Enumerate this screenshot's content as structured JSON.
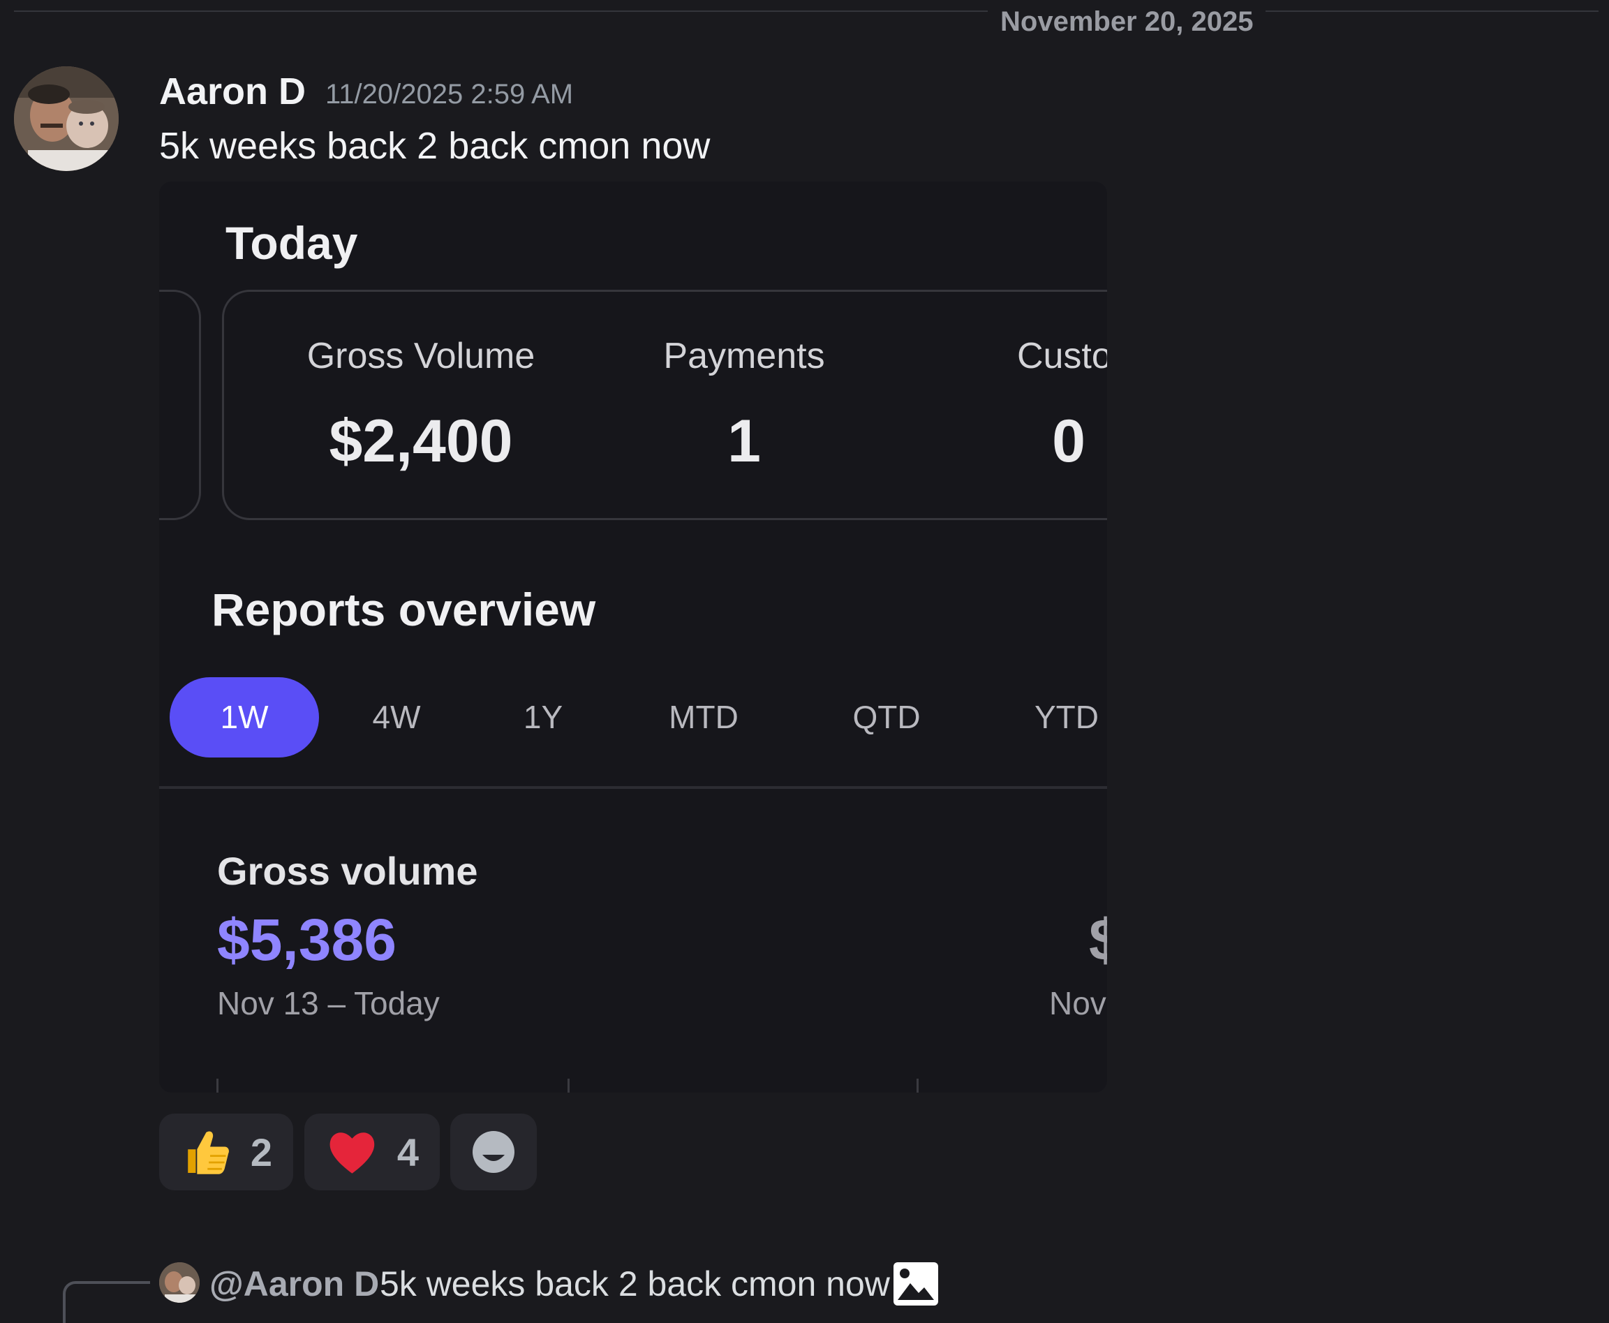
{
  "date_divider": "November 20, 2025",
  "message": {
    "author": "Aaron D",
    "timestamp": "11/20/2025 2:59 AM",
    "text": "5k weeks back 2 back cmon now"
  },
  "embed": {
    "today_title": "Today",
    "stats": [
      {
        "label": "Gross Volume",
        "value": "$2,400"
      },
      {
        "label": "Payments",
        "value": "1"
      },
      {
        "label": "Custome",
        "value": "0"
      }
    ],
    "reports_title": "Reports overview",
    "tabs": [
      "1W",
      "4W",
      "1Y",
      "MTD",
      "QTD",
      "YTD"
    ],
    "active_tab": "1W",
    "gross_volume": {
      "label": "Gross volume",
      "value": "$5,386",
      "range": "Nov 13 – Today",
      "comparison_value": "$",
      "comparison_range": "Nov"
    }
  },
  "reactions": [
    {
      "emoji": "thumbs-up",
      "count": "2"
    },
    {
      "emoji": "heart",
      "count": "4"
    }
  ],
  "reply": {
    "author": "@Aaron D",
    "text": "5k weeks back 2 back cmon now"
  },
  "colors": {
    "background": "#1a1a1e",
    "accent": "#5a4ef6",
    "gross_volume": "#8f85ff"
  }
}
